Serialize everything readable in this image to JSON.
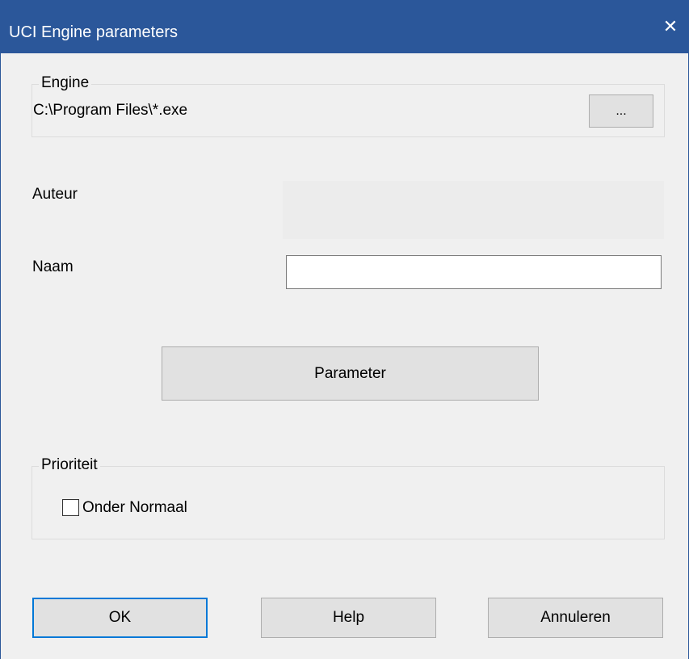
{
  "window": {
    "title": "UCI Engine parameters",
    "close_glyph": "✕"
  },
  "engine_group": {
    "label": "Engine",
    "path": "C:\\Program Files\\*.exe",
    "browse_label": "..."
  },
  "auteur": {
    "label": "Auteur",
    "value": ""
  },
  "naam": {
    "label": "Naam",
    "value": ""
  },
  "parameter_button": {
    "label": "Parameter"
  },
  "priority_group": {
    "label": "Prioriteit",
    "checkbox_label": "Onder Normaal",
    "checked": false
  },
  "buttons": {
    "ok": "OK",
    "help": "Help",
    "cancel": "Annuleren"
  },
  "colors": {
    "titlebar": "#2b579a",
    "background": "#f0f0f0",
    "default_button_border": "#0078d7"
  }
}
